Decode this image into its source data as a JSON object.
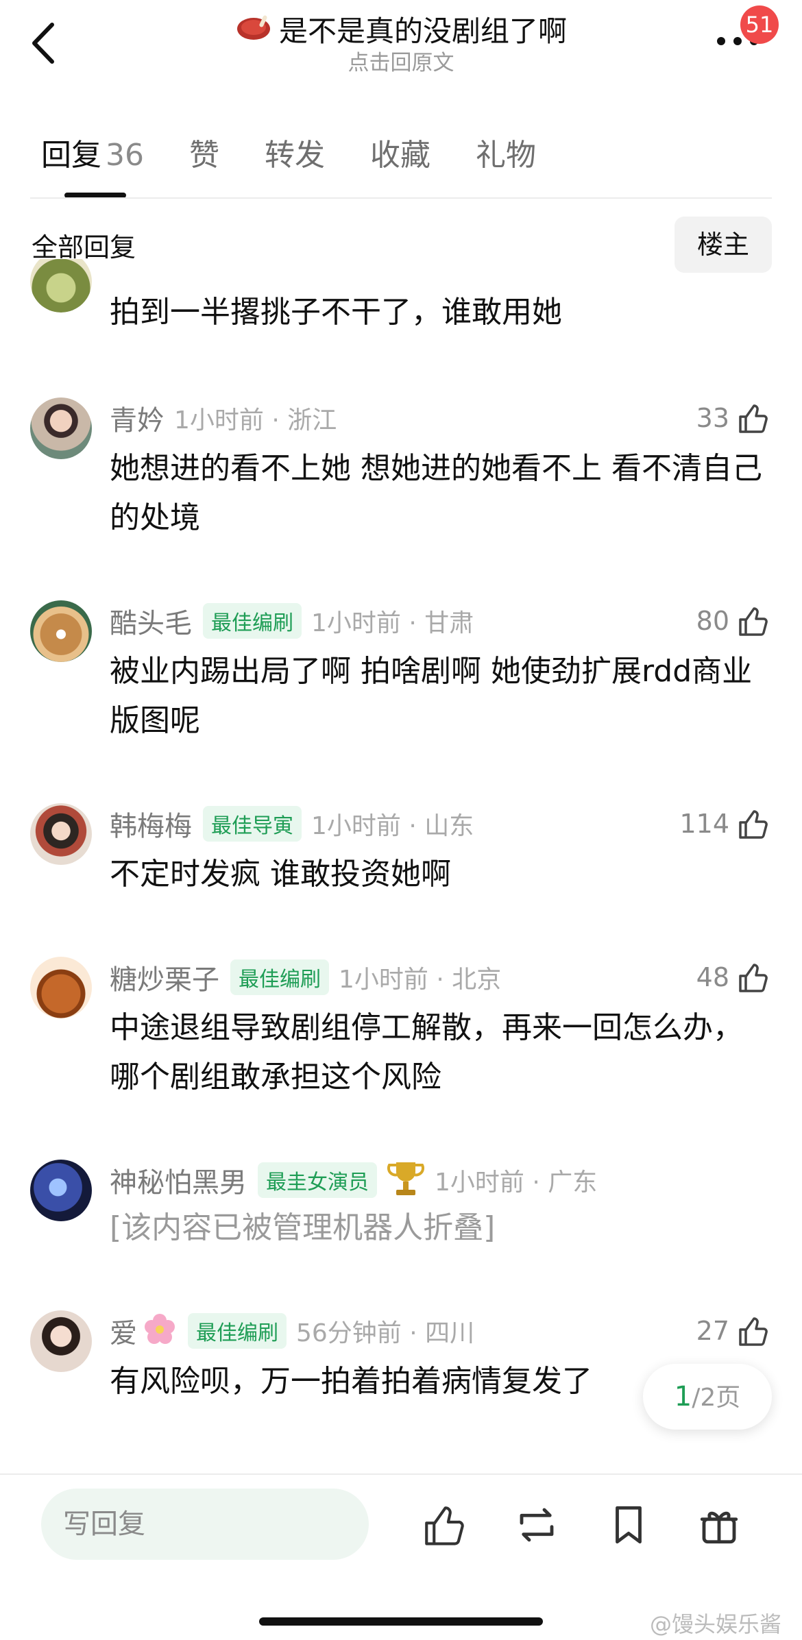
{
  "header": {
    "title": "是不是真的没剧组了啊",
    "subtitle": "点击回原文",
    "badge_count": "51"
  },
  "tabs": [
    {
      "label": "回复",
      "count": "36",
      "active": true
    },
    {
      "label": "赞",
      "count": "",
      "active": false
    },
    {
      "label": "转发",
      "count": "",
      "active": false
    },
    {
      "label": "收藏",
      "count": "",
      "active": false
    },
    {
      "label": "礼物",
      "count": "",
      "active": false
    }
  ],
  "filter": {
    "label": "全部回复",
    "button": "楼主"
  },
  "partial_comment": {
    "text": "拍到一半撂挑子不干了，谁敢用她"
  },
  "comments": [
    {
      "name": "青妗",
      "tag": "",
      "time": "1小时前 · 浙江",
      "likes": "33",
      "text": "她想进的看不上她 想她进的她看不上 看不清自己的处境"
    },
    {
      "name": "酷头毛",
      "tag": "最佳编刷",
      "time": "1小时前 · 甘肃",
      "likes": "80",
      "text": "被业内踢出局了啊 拍啥剧啊 她使劲扩展rdd商业版图呢"
    },
    {
      "name": "韩梅梅",
      "tag": "最佳导寅",
      "time": "1小时前 · 山东",
      "likes": "114",
      "text": "不定时发疯 谁敢投资她啊"
    },
    {
      "name": "糖炒栗子",
      "tag": "最佳编刷",
      "time": "1小时前 · 北京",
      "likes": "48",
      "text": "中途退组导致剧组停工解散，再来一回怎么办，哪个剧组敢承担这个风险"
    },
    {
      "name": "神秘怕黑男",
      "tag": "最圭女演员",
      "time": "1小时前 · 广东",
      "likes": "",
      "text": "[该内容已被管理机器人折叠]"
    },
    {
      "name": "爱",
      "tag": "最佳编刷",
      "time": "56分钟前 · 四川",
      "likes": "27",
      "text": "有风险呗，万一拍着拍着病情复发了"
    }
  ],
  "pagination": {
    "current": "1",
    "total": "/2页"
  },
  "bottom_bar": {
    "input_placeholder": "写回复"
  },
  "watermark": "@馒头娱乐酱",
  "colors": {
    "accent_green": "#1e9d55",
    "badge_red": "#f04a4a"
  }
}
